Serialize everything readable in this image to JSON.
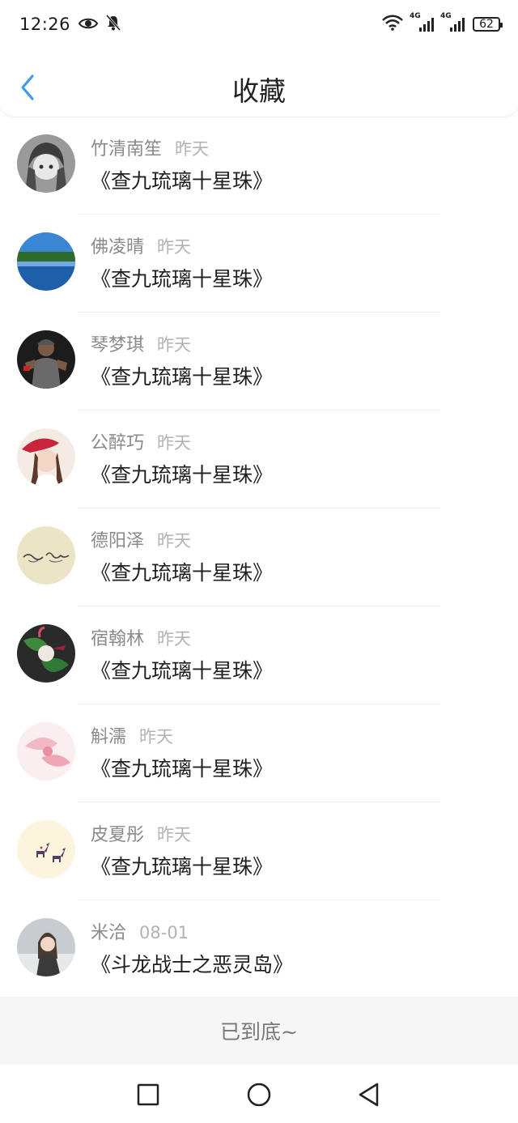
{
  "status_bar": {
    "time": "12:26",
    "network_1": "4G",
    "network_2": "4G",
    "battery": "62"
  },
  "header": {
    "title": "收藏",
    "accent_color": "#3b9cf0"
  },
  "items": [
    {
      "author": "竹清南笙",
      "time": "昨天",
      "title": "《查九琉璃十星珠》",
      "avatar": "anime-girl"
    },
    {
      "author": "佛凌晴",
      "time": "昨天",
      "title": "《查九琉璃十星珠》",
      "avatar": "lake-landscape"
    },
    {
      "author": "琴梦琪",
      "time": "昨天",
      "title": "《查九琉璃十星珠》",
      "avatar": "man-in-cap"
    },
    {
      "author": "公醉巧",
      "time": "昨天",
      "title": "《查九琉璃十星珠》",
      "avatar": "girl-red-hat"
    },
    {
      "author": "德阳泽",
      "time": "昨天",
      "title": "《查九琉璃十星珠》",
      "avatar": "handwriting"
    },
    {
      "author": "宿翰林",
      "time": "昨天",
      "title": "《查九琉璃十星珠》",
      "avatar": "artistic-green"
    },
    {
      "author": "斛濡",
      "time": "昨天",
      "title": "《查九琉璃十星珠》",
      "avatar": "pink-flower"
    },
    {
      "author": "皮夏彤",
      "time": "昨天",
      "title": "《查九琉璃十星珠》",
      "avatar": "deer"
    },
    {
      "author": "米洽",
      "time": "08-01",
      "title": "《斗龙战士之恶灵岛》",
      "avatar": "girl-winter"
    }
  ],
  "footer": {
    "end_text": "已到底~"
  }
}
